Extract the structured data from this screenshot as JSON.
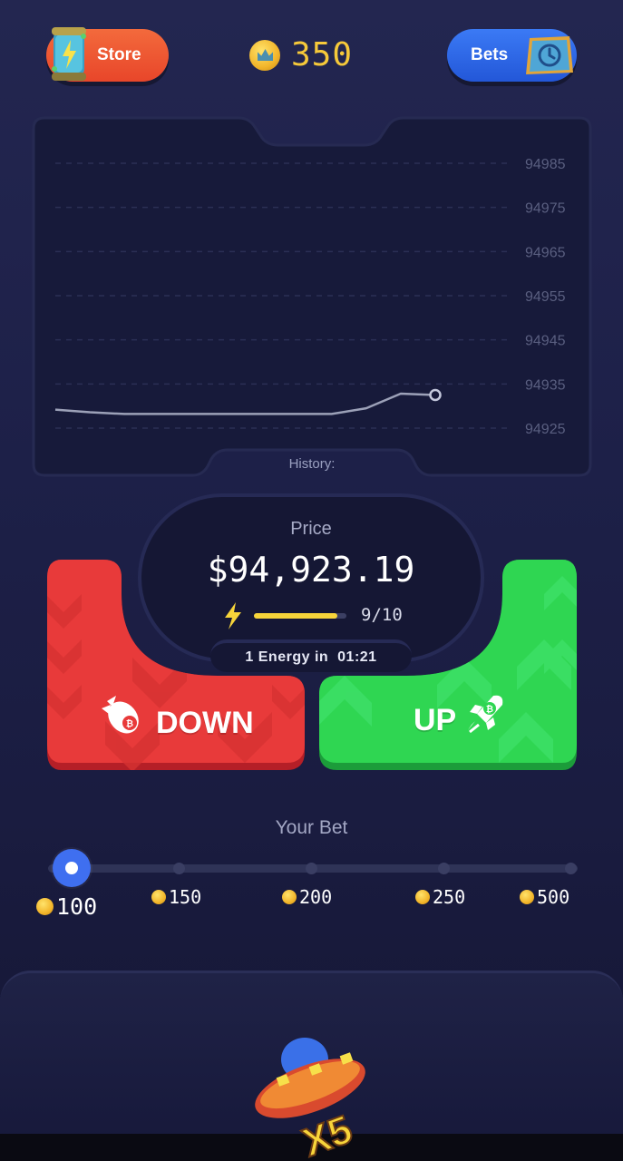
{
  "header": {
    "store_label": "Store",
    "bets_label": "Bets",
    "balance": "350",
    "icons": {
      "store": "energy-can-icon",
      "bets": "history-clock-icon",
      "coin": "crown-coin-icon"
    }
  },
  "chart": {
    "history_label": "History:"
  },
  "chart_data": {
    "type": "line",
    "y_ticks": [
      "94985",
      "94975",
      "94965",
      "94955",
      "94945",
      "94935",
      "94925"
    ],
    "ylim": [
      94925,
      94985
    ],
    "grid": true,
    "series": [
      {
        "values": [
          94929.2,
          94928.6,
          94928.2,
          94928.2,
          94928.2,
          94928.2,
          94928.2,
          94928.2,
          94928.2,
          94929.5,
          94932.8,
          94932.5
        ]
      }
    ]
  },
  "price": {
    "label": "Price",
    "value": "$94,923.19",
    "energy_count": "9/10",
    "energy_fraction": 0.9,
    "energy_timer_label": "1 Energy in",
    "energy_timer_value": "01:21"
  },
  "actions": {
    "down_label": "DOWN",
    "up_label": "UP",
    "colors": {
      "down": "#e83a3a",
      "up": "#2fd652"
    }
  },
  "bet": {
    "title": "Your Bet",
    "options": [
      "100",
      "150",
      "200",
      "250",
      "500"
    ],
    "selected": "100"
  },
  "bottom": {
    "ufo_badge": "X5"
  }
}
